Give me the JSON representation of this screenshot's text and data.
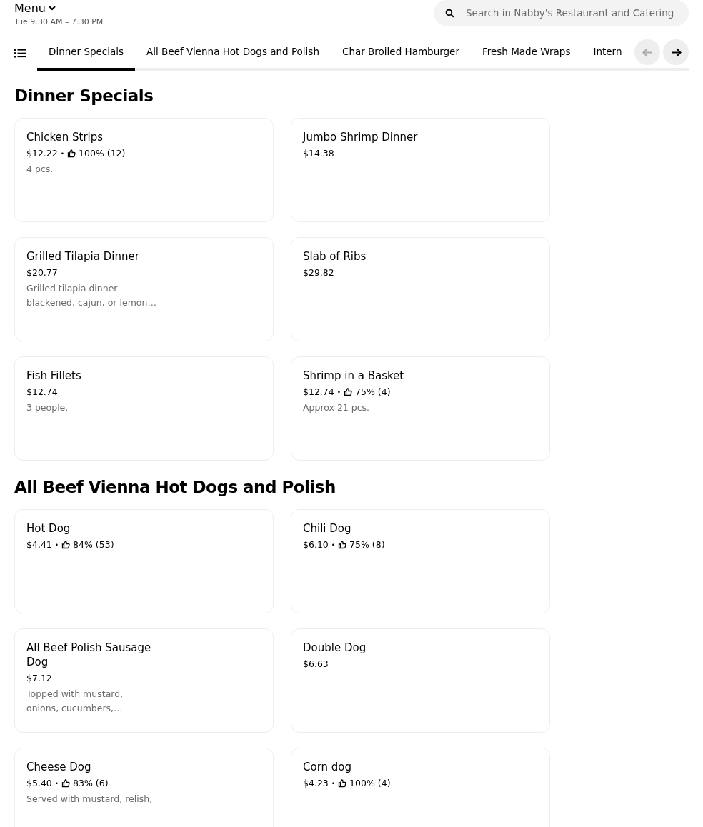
{
  "header": {
    "menu_label": "Menu",
    "hours": "Tue 9:30 AM – 7:30 PM",
    "search": {
      "placeholder": "Search in Nabby's Restaurant and Catering"
    }
  },
  "tabs": [
    {
      "label": "Dinner Specials",
      "selected": true
    },
    {
      "label": "All Beef Vienna Hot Dogs and Polish",
      "selected": false
    },
    {
      "label": "Char Broiled Hamburger",
      "selected": false
    },
    {
      "label": "Fresh Made Wraps",
      "selected": false
    },
    {
      "label": "Intern",
      "selected": false
    }
  ],
  "tab_nav": {
    "prev_disabled": true,
    "next_disabled": false
  },
  "sections": [
    {
      "title": "Dinner Specials",
      "items": [
        {
          "name": "Chicken Strips",
          "price": "$12.22",
          "separator": "•",
          "rating": "100% (12)",
          "description": "4 pcs."
        },
        {
          "name": "Jumbo Shrimp Dinner",
          "price": "$14.38"
        },
        {
          "name": "Grilled Tilapia Dinner",
          "price": "$20.77",
          "description": "Grilled tilapia dinner blackened, cajun, or lemon…"
        },
        {
          "name": "Slab of Ribs",
          "price": "$29.82"
        },
        {
          "name": "Fish Fillets",
          "price": "$12.74",
          "description": "3 people."
        },
        {
          "name": "Shrimp in a Basket",
          "price": "$12.74",
          "separator": "•",
          "rating": "75% (4)",
          "description": "Approx 21 pcs."
        }
      ]
    },
    {
      "title": "All Beef Vienna Hot Dogs and Polish",
      "items": [
        {
          "name": "Hot Dog",
          "price": "$4.41",
          "separator": "•",
          "rating": "84% (53)"
        },
        {
          "name": "Chili Dog",
          "price": "$6.10",
          "separator": "•",
          "rating": "75% (8)"
        },
        {
          "name": "All Beef Polish Sausage Dog",
          "price": "$7.12",
          "description": "Topped with mustard, onions, cucumbers,…"
        },
        {
          "name": "Double Dog",
          "price": "$6.63"
        },
        {
          "name": "Cheese Dog",
          "price": "$5.40",
          "separator": "•",
          "rating": "83% (6)",
          "description": "Served with mustard, relish,"
        },
        {
          "name": "Corn dog",
          "price": "$4.23",
          "separator": "•",
          "rating": "100% (4)"
        }
      ]
    }
  ]
}
